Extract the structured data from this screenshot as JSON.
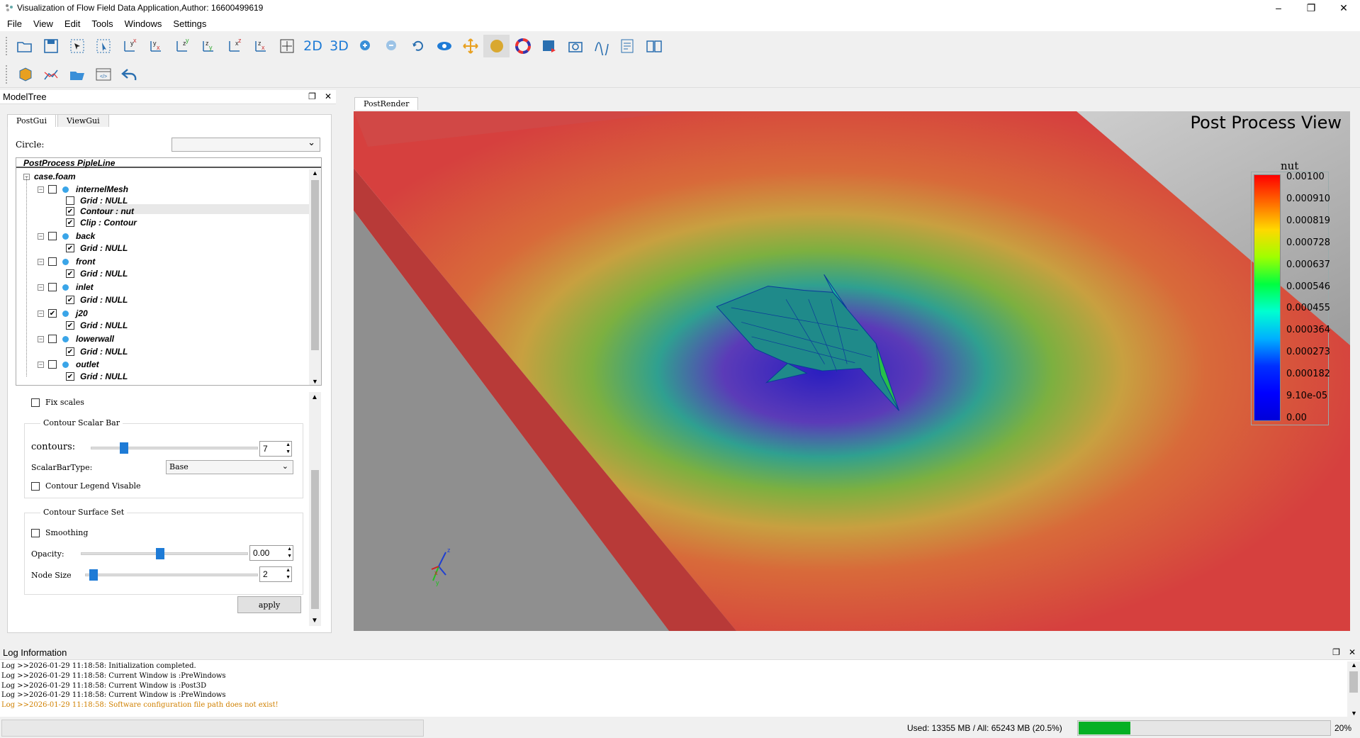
{
  "window": {
    "title": "Visualization of Flow Field Data Application,Author: 16600499619",
    "controls": [
      "–",
      "❐",
      "✕"
    ]
  },
  "menu": [
    "File",
    "View",
    "Edit",
    "Tools",
    "Windows",
    "Settings"
  ],
  "toolbar1": {
    "btn_2d": "2D",
    "btn_3d": "3D"
  },
  "modeltree": {
    "title": "ModelTree",
    "tabs": [
      "PostGui",
      "ViewGui"
    ],
    "circle_label": "Circle:",
    "circle_value": "",
    "pipeline_header": "PostProcess PipleLine",
    "items": [
      {
        "label": "case.foam"
      },
      {
        "label": "internelMesh",
        "checked": false
      },
      {
        "label": "Grid : NULL",
        "checked": false
      },
      {
        "label": "Contour : nut",
        "checked": true
      },
      {
        "label": "Clip : Contour",
        "checked": true
      },
      {
        "label": "back",
        "checked": false
      },
      {
        "label": "Grid : NULL",
        "checked": true
      },
      {
        "label": "front",
        "checked": false
      },
      {
        "label": "Grid : NULL",
        "checked": true
      },
      {
        "label": "inlet",
        "checked": false
      },
      {
        "label": "Grid : NULL",
        "checked": true
      },
      {
        "label": "j20",
        "checked": true
      },
      {
        "label": "Grid : NULL",
        "checked": true
      },
      {
        "label": "lowerwall",
        "checked": false
      },
      {
        "label": "Grid : NULL",
        "checked": true
      },
      {
        "label": "outlet",
        "checked": false
      },
      {
        "label": "Grid : NULL",
        "checked": true
      }
    ]
  },
  "settings": {
    "fix_scales": "Fix scales",
    "fix_scales_checked": false,
    "scalar_bar_group": "Contour Scalar Bar",
    "contours_label": "contours:",
    "contours_value": "7",
    "contours_slider_fraction": 0.18,
    "scalar_bar_type_label": "ScalarBarType:",
    "scalar_bar_type_value": "Base",
    "legend_visible_label": "Contour Legend Visable",
    "surface_group": "Contour Surface Set",
    "smoothing_label": "Smoothing",
    "opacity_label": "Opacity:",
    "opacity_value": "0.00",
    "opacity_slider_fraction": 0.47,
    "node_size_label": "Node Size",
    "node_size_value": "2",
    "node_size_slider_fraction": 0.02,
    "apply_label": "apply"
  },
  "render": {
    "tab": "PostRender",
    "title": "Post Process View",
    "legend_title": "nut",
    "legend_labels": [
      "0.00100",
      "0.000910",
      "0.000819",
      "0.000728",
      "0.000637",
      "0.000546",
      "0.000455",
      "0.000364",
      "0.000273",
      "0.000182",
      "9.10e-05",
      "0.00"
    ],
    "axes": {
      "x": "x",
      "y": "y",
      "z": "z"
    }
  },
  "log": {
    "title": "Log Information",
    "lines": [
      {
        "text": "Log >>2026-01-29 11:18:58: Initialization completed.",
        "warn": false
      },
      {
        "text": "Log >>2026-01-29 11:18:58: Current Window is :PreWindows",
        "warn": false
      },
      {
        "text": "Log >>2026-01-29 11:18:58: Current Window is :Post3D",
        "warn": false
      },
      {
        "text": "Log >>2026-01-29 11:18:58: Current Window is :PreWindows",
        "warn": false
      },
      {
        "text": "Log >>2026-01-29 11:18:58: Software configuration file path does not exist!",
        "warn": true
      }
    ]
  },
  "status": {
    "memory": "Used: 13355 MB / All: 65243 MB (20.5%)",
    "progress_fraction": 0.205,
    "percent": "20%"
  }
}
